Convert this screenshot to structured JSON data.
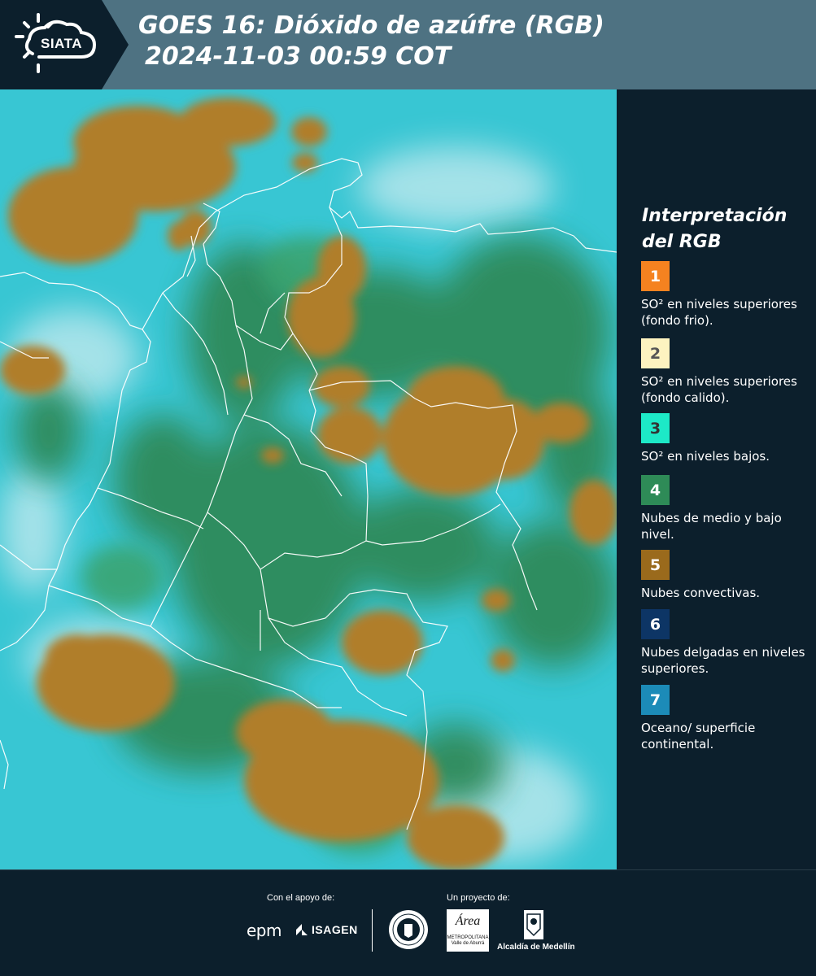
{
  "header": {
    "logo_text": "SIATA",
    "title_line1": "GOES 16: Dióxido de azúfre (RGB)",
    "title_line2": "2024-11-03 00:59 COT"
  },
  "legend": {
    "title": "Interpretación del RGB",
    "items": [
      {
        "number": "1",
        "label": "SO² en niveles superiores (fondo frio).",
        "color": "#f58220"
      },
      {
        "number": "2",
        "label": "SO² en niveles superiores (fondo calido).",
        "color": "#fdf3c0"
      },
      {
        "number": "3",
        "label": "SO² en niveles bajos.",
        "color": "#1de9c7"
      },
      {
        "number": "4",
        "label": "Nubes de medio y bajo nivel.",
        "color": "#2e8b57"
      },
      {
        "number": "5",
        "label": "Nubes convectivas.",
        "color": "#9a6a1c"
      },
      {
        "number": "6",
        "label": "Nubes delgadas en niveles superiores.",
        "color": "#0d3565"
      },
      {
        "number": "7",
        "label": "Oceano/ superficie continental.",
        "color": "#1c8bb8"
      }
    ]
  },
  "footer": {
    "support_label": "Con el apoyo de:",
    "project_label": "Un proyecto de:",
    "sponsor1": "epm",
    "sponsor2": "ISAGEN",
    "area_logo": "Área",
    "area_sub": "METROPOLITANA Valle de Aburrá",
    "alcaldia": "Alcaldía de Medellín"
  },
  "colors": {
    "header_bg": "#4e7282",
    "logo_bg": "#0c1f2c",
    "cloud_convective": "#b07e2a",
    "cloud_low": "#2f8a5a",
    "surface": "#33c8d6"
  }
}
